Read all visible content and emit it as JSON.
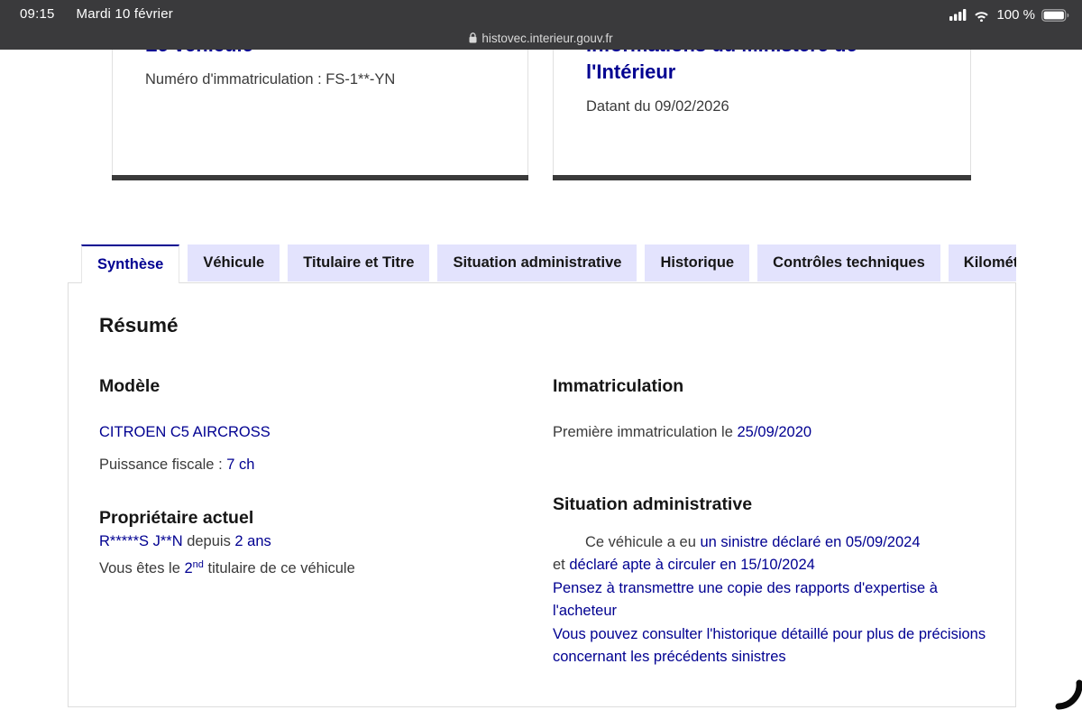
{
  "status_bar": {
    "time": "09:15",
    "date": "Mardi 10 février",
    "battery_pct": "100 %",
    "url": "histovec.interieur.gouv.fr"
  },
  "cards": {
    "vehicle": {
      "title": "Le véhicule",
      "body": "Numéro d'immatriculation : FS-1**-YN"
    },
    "ministry": {
      "title": "Informations du Ministère de l'Intérieur",
      "body": "Datant du 09/02/2026"
    }
  },
  "tabs": {
    "items": [
      {
        "label": "Synthèse",
        "active": true
      },
      {
        "label": "Véhicule",
        "active": false
      },
      {
        "label": "Titulaire et Titre",
        "active": false
      },
      {
        "label": "Situation administrative",
        "active": false
      },
      {
        "label": "Historique",
        "active": false
      },
      {
        "label": "Contrôles techniques",
        "active": false
      },
      {
        "label": "Kilométrage",
        "active": false
      }
    ]
  },
  "panel": {
    "heading": "Résumé",
    "model": {
      "heading": "Modèle",
      "name": "CITROEN C5 AIRCROSS",
      "power_label": "Puissance fiscale : ",
      "power_value": "7 ch"
    },
    "owner": {
      "heading": "Propriétaire actuel",
      "name": "R*****S J**N",
      "since_label": " depuis ",
      "since_value": "2 ans",
      "holder_prefix": "Vous êtes le ",
      "holder_rank": "2",
      "holder_rank_sup": "nd",
      "holder_suffix": " titulaire de ce véhicule"
    },
    "registration": {
      "heading": "Immatriculation",
      "label": "Première immatriculation le ",
      "value": "25/09/2020"
    },
    "situation": {
      "heading": "Situation administrative",
      "line1_prefix": "Ce véhicule a eu ",
      "line1_value": "un sinistre déclaré en 05/09/2024",
      "line2_prefix": "et ",
      "line2_value": "déclaré apte à circuler en 15/10/2024",
      "line3": "Pensez à transmettre une copie des rapports d'expertise à l'acheteur",
      "line4": "Vous pouvez consulter l'historique détaillé pour plus de précisions concernant les précédents sinistres"
    }
  },
  "colors": {
    "accent_blue": "#000091",
    "tab_inactive_bg": "#e3e3fd",
    "statusbar_bg": "#3a3a3c",
    "body_gray": "#3a3a3a",
    "heading": "#161616"
  }
}
